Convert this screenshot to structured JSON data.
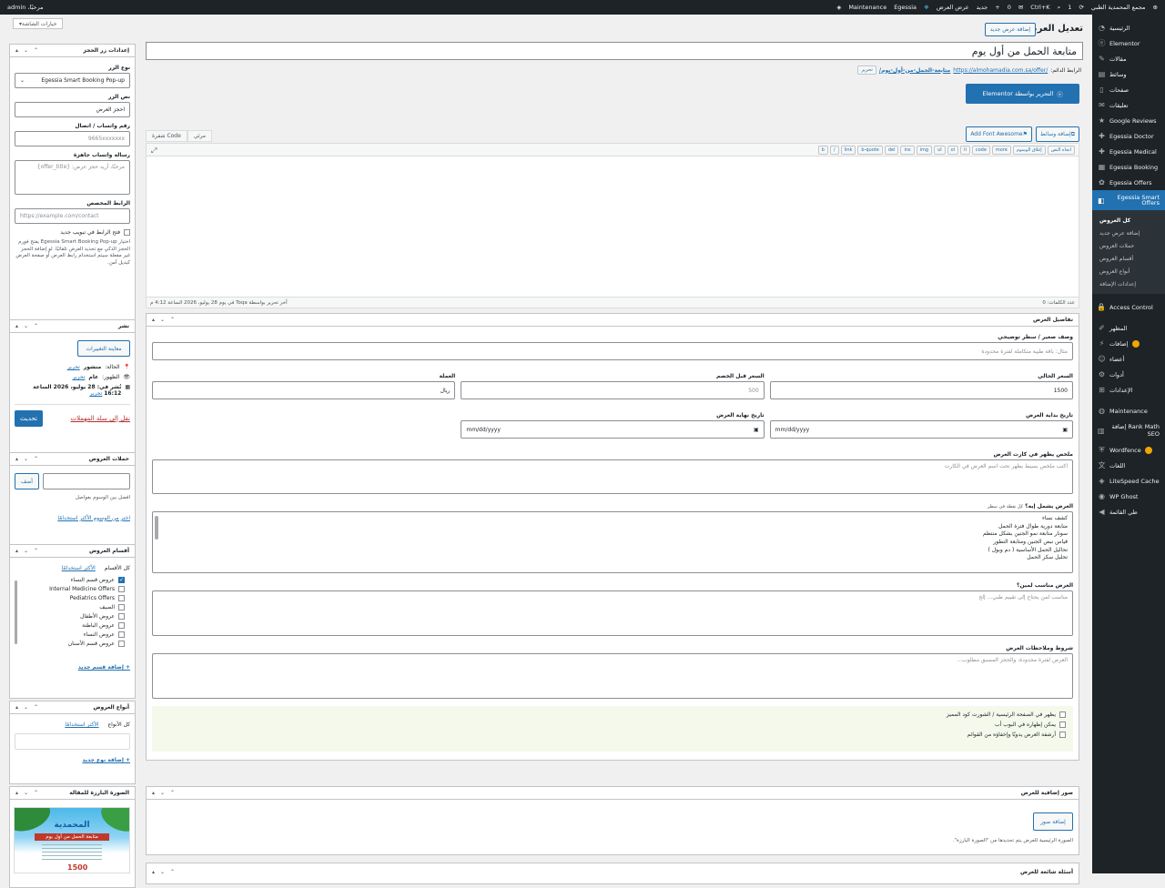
{
  "adminbar": {
    "site": "مجمع المحمدية الطبي",
    "counter": "1",
    "shortcut": "Ctrl+K",
    "comments": "0",
    "new": "جديد",
    "view": "عرض العرض",
    "egessia": "Egessia",
    "maintenance": "Maintenance",
    "greeting": "مرحبًا، admin"
  },
  "menu": {
    "items": [
      {
        "label": "الرئيسية",
        "icon": "dashboard-icon"
      },
      {
        "label": "Elementor",
        "icon": "elementor-icon"
      },
      {
        "label": "مقالات",
        "icon": "pin-icon"
      },
      {
        "label": "وسائط",
        "icon": "media-icon"
      },
      {
        "label": "صفحات",
        "icon": "pages-icon"
      },
      {
        "label": "تعليقات",
        "icon": "comments-icon"
      },
      {
        "label": "Google Reviews",
        "icon": "star-icon"
      },
      {
        "label": "Egessia Doctor",
        "icon": "doctor-icon"
      },
      {
        "label": "Egessia Medical",
        "icon": "medical-icon"
      },
      {
        "label": "Egessia Booking",
        "icon": "calendar-icon"
      },
      {
        "label": "Egessia Offers",
        "icon": "tag-icon"
      }
    ],
    "active": "Egessia Smart Offers",
    "submenu": [
      "كل العروض",
      "إضافة عرض جديد",
      "حملات العروض",
      "أقسام العروض",
      "أنواع العروض",
      "إعدادات الإضافة"
    ],
    "items2": [
      {
        "label": "Access Control",
        "icon": "lock-icon"
      },
      {
        "label": "المظهر",
        "icon": "brush-icon"
      },
      {
        "label": "إضافات",
        "icon": "plugin-icon"
      },
      {
        "label": "أعضاء",
        "icon": "user-icon"
      },
      {
        "label": "أدوات",
        "icon": "wrench-icon"
      },
      {
        "label": "الإعدادات",
        "icon": "settings-icon"
      },
      {
        "label": "Maintenance",
        "icon": "maintenance-icon"
      },
      {
        "label": "Rank Math إضافة SEO",
        "icon": "chart-icon"
      },
      {
        "label": "Wordfence",
        "icon": "shield-icon"
      },
      {
        "label": "اللغات",
        "icon": "language-icon"
      },
      {
        "label": "LiteSpeed Cache",
        "icon": "diamond-icon"
      },
      {
        "label": "WP Ghost",
        "icon": "ghost-icon"
      },
      {
        "label": "طي القائمة",
        "icon": "collapse-icon"
      }
    ]
  },
  "page": {
    "screen_options": "خيارات الشاشة",
    "title": "تعديل العرض",
    "add_new": "إضافة عرض جديد",
    "post_title": "متابعة الحمل من أول يوم",
    "permalink_label": "الرابط الدائم:",
    "permalink_base": "https://almohamadia.com.sa/offer/",
    "permalink_slug": "متابعة-الحمل-من-أول-يوم/",
    "permalink_edit": "تحرير",
    "elementor_btn": "التحرير بواسطة Elementor"
  },
  "editor": {
    "add_media": "إضافة وسائط",
    "font_awesome": "Add Font Awesome",
    "tab_visual": "مرئي",
    "tab_code": "Code شفرة",
    "quicktags": [
      "b",
      "/",
      "link",
      "b-quote",
      "del",
      "ins",
      "img",
      "ul",
      "ol",
      "li",
      "code",
      "more",
      "إغلاق الوسوم",
      "اتجاه النص"
    ],
    "word_count": "عدد الكلمات: 0",
    "last_edit": "آخر تحرير بواسطة Toqa في يوم 28 يوليو، 2026 الساعة 4:12 م"
  },
  "details": {
    "title": "تفاصيل العرض",
    "short_desc_label": "وصف صغير / سطر توضيحي",
    "short_desc_ph": "مثال: باقة طبية متكاملة لفترة محدودة",
    "price_label": "السعر الحالي",
    "price_val": "1500",
    "old_price_label": "السعر قبل الخصم",
    "old_price_val": "500",
    "currency_label": "العملة",
    "currency_val": "ريال",
    "start_label": "تاريخ بداية العرض",
    "end_label": "تاريخ نهاية العرض",
    "date_ph": "mm/dd/yyyy",
    "summary_label": "ملخص يظهر في كارت العرض",
    "summary_ph": "اكتب ملخص بسيط يظهر تحت اسم العرض في الكارت",
    "includes_label": "العرض يشمل إيه؟",
    "includes_hint": "كل نقطة في سطر",
    "includes": [
      "كشف نساء",
      "متابعة دورية طوال فترة الحمل",
      "سونار متابعة نمو الجنين بشكل منتظم",
      "قياس نبض الجنين ومتابعة التطور",
      "تحاليل الحمل الأساسية ( دم وبول )",
      "تحليل سكر الحمل"
    ],
    "suitable_label": "العرض مناسب لمين؟",
    "suitable_ph": "مناسب لمن يحتاج إلى تقييم طبي... إلخ",
    "terms_label": "شروط وملاحظات العرض",
    "terms_ph": "العرض لفترة محدودة، والحجز المسبق مطلوب...",
    "checks": [
      "يظهر في الصفحة الرئيسية / الشورت كود المميز",
      "يمكن إظهاره في البوب أب",
      "أرشفة العرض يدويًا وإخفاؤه من القوائم"
    ]
  },
  "gallery": {
    "title": "صور إضافية للعرض",
    "btn": "إضافة صور",
    "note": "الصورة الرئيسية للعرض يتم تحديدها من \"الصورة البارزة\"."
  },
  "faq": {
    "title": "أسئلة شائعة للعرض"
  },
  "booking": {
    "title": "إعدادات زر الحجز",
    "type_label": "نوع الزر",
    "type_val": "Egessia Smart Booking Pop-up",
    "text_label": "نص الزر",
    "text_val": "احجز العرض",
    "wa_label": "رقم واتساب / اتصال",
    "wa_ph": "9665xxxxxxx",
    "msg_label": "رسالة واتساب جاهزة",
    "msg_ph": "مرحبًا، أريد حجز عرض: {offer_title}",
    "custom_label": "الرابط المخصص",
    "custom_ph": "https://example.com/contact",
    "newtab": "فتح الرابط في تبويب جديد",
    "note": "اختيار Egessia Smart Booking Pop-up يفتح فورم الحجز الذكي مع تحديد العرض تلقائيًا. لو إضافة الحجز غير مفعلة سيتم استخدام رابط العرض أو صفحة العرض كبديل آمن."
  },
  "publish": {
    "title": "نشر",
    "preview": "معاينة التغييرات",
    "status_label": "الحالة:",
    "status_val": "منشور",
    "visibility_label": "الظهور:",
    "visibility_val": "عام",
    "edit": "تحرير",
    "date_line": "نُشر في: 28 يوليو، 2026 الساعة",
    "time": "16:12",
    "trash": "نقل إلى سلة المهملات",
    "update": "تحديث"
  },
  "campaigns": {
    "title": "حملات العروض",
    "add": "أضف",
    "note": "افصل بين الوسوم بفواصل",
    "choose": "اختر من الوسوم الأكثر استخدامًا"
  },
  "sections": {
    "title": "أقسام العروض",
    "tab_all": "كل الأقسام",
    "tab_popular": "الأكثر استخدامًا",
    "items": [
      {
        "label": "عروض قسم النساء",
        "checked": true
      },
      {
        "label": "Internal Medicine Offers",
        "checked": false
      },
      {
        "label": "Pediatrics Offers",
        "checked": false
      },
      {
        "label": "الصيف",
        "checked": false
      },
      {
        "label": "عروض الأطفال",
        "checked": false
      },
      {
        "label": "عروض الباطنة",
        "checked": false
      },
      {
        "label": "عروض النساء",
        "checked": false
      },
      {
        "label": "عروض قسم الأسنان",
        "checked": false
      }
    ],
    "add": "+ إضافة قسم جديد"
  },
  "types": {
    "title": "أنواع العروض",
    "tab_all": "كل الأنواع",
    "tab_popular": "الأكثر استخدامًا",
    "add": "+ إضافة نوع جديد"
  },
  "featured": {
    "title": "الصورة البارزة للمقالة",
    "img_brand": "المحمدية",
    "img_title": "متابعة الحمل من أول يوم",
    "img_price": "1500"
  }
}
